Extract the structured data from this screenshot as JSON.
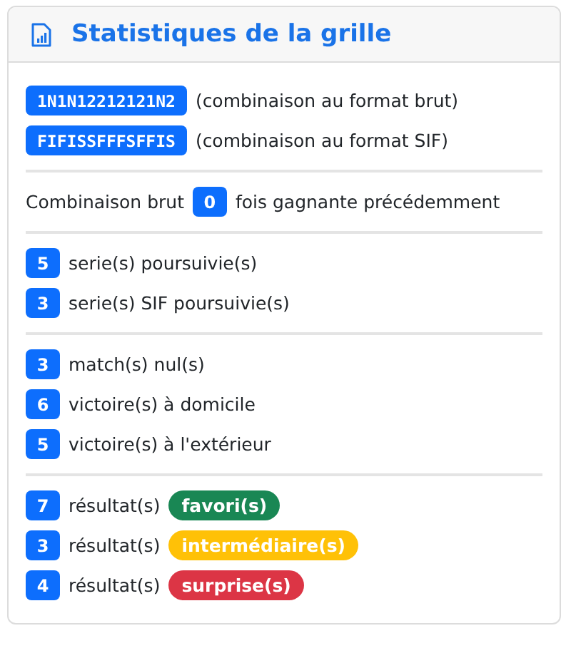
{
  "card": {
    "title": "Statistiques de la grille"
  },
  "groups": [
    {
      "items": [
        {
          "kind": "code",
          "badge": "1N1N12212121N2",
          "text": "(combinaison au format brut)"
        },
        {
          "kind": "code",
          "badge": "FIFISSFFFSFFIS",
          "text": "(combinaison au format SIF)"
        }
      ]
    },
    {
      "items": [
        {
          "kind": "inline",
          "before": "Combinaison brut",
          "badge": "0",
          "text": "fois gagnante précédemment"
        }
      ]
    },
    {
      "items": [
        {
          "kind": "count",
          "badge": "5",
          "text": "serie(s) poursuivie(s)"
        },
        {
          "kind": "count",
          "badge": "3",
          "text": "serie(s) SIF poursuivie(s)"
        }
      ]
    },
    {
      "items": [
        {
          "kind": "count",
          "badge": "3",
          "text": "match(s) nul(s)"
        },
        {
          "kind": "count",
          "badge": "6",
          "text": "victoire(s) à domicile"
        },
        {
          "kind": "count",
          "badge": "5",
          "text": "victoire(s) à l'extérieur"
        }
      ]
    },
    {
      "items": [
        {
          "kind": "result",
          "badge": "7",
          "text": "résultat(s)",
          "tag": "favori(s)",
          "color": "#198754"
        },
        {
          "kind": "result",
          "badge": "3",
          "text": "résultat(s)",
          "tag": "intermédiaire(s)",
          "color": "#ffc107"
        },
        {
          "kind": "result",
          "badge": "4",
          "text": "résultat(s)",
          "tag": "surprise(s)",
          "color": "#dc3545"
        }
      ]
    }
  ]
}
